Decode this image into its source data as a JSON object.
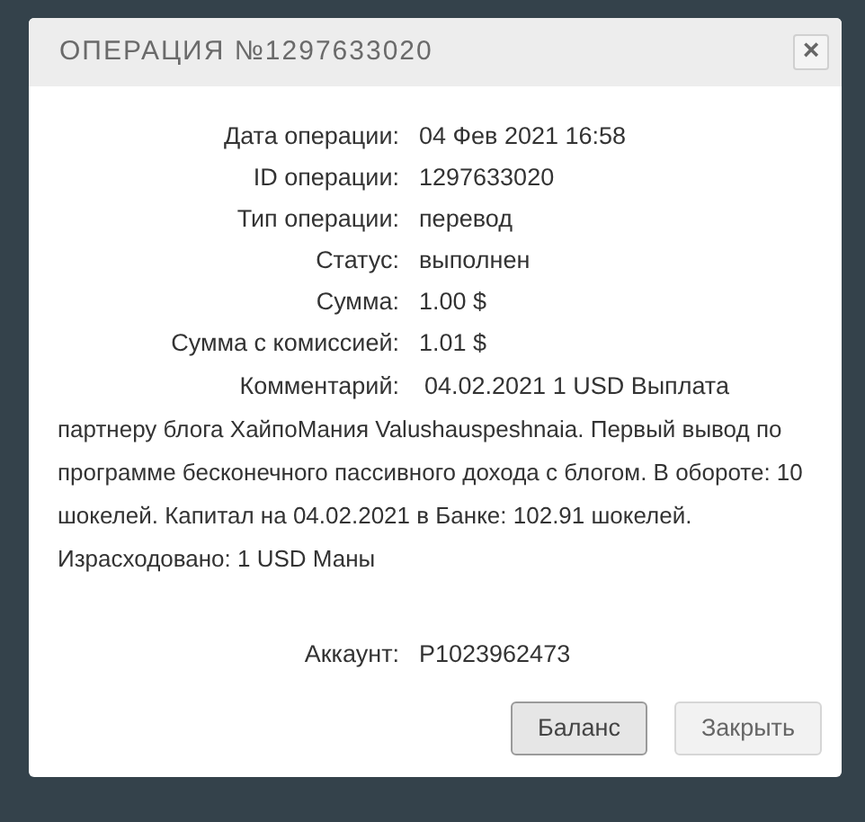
{
  "dialog": {
    "title": "ОПЕРАЦИЯ №1297633020",
    "close_label": "×",
    "fields": [
      {
        "label": "Дата операции:",
        "value": "04 Фев 2021 16:58"
      },
      {
        "label": "ID операции:",
        "value": "1297633020"
      },
      {
        "label": "Тип операции:",
        "value": "перевод"
      },
      {
        "label": "Статус:",
        "value": "выполнен"
      },
      {
        "label": "Сумма:",
        "value": "1.00 $"
      },
      {
        "label": "Сумма с комиссией:",
        "value": "1.01 $"
      }
    ],
    "comment": {
      "label": "Комментарий:",
      "first_line": "04.02.2021 1 USD Выплата",
      "continuation": "партнеру блога ХайпоМания Valushauspeshnaia. Первый вывод по программе бесконечного пассивного дохода с блогом. В обороте: 10 шокелей. Капитал на 04.02.2021 в Банке: 102.91 шокелей. Израсходовано: 1 USD Маны"
    },
    "account": {
      "label": "Аккаунт:",
      "value": "P1023962473"
    },
    "buttons": [
      {
        "label": "Баланс",
        "focused": true
      },
      {
        "label": "Закрыть",
        "focused": false
      }
    ]
  }
}
